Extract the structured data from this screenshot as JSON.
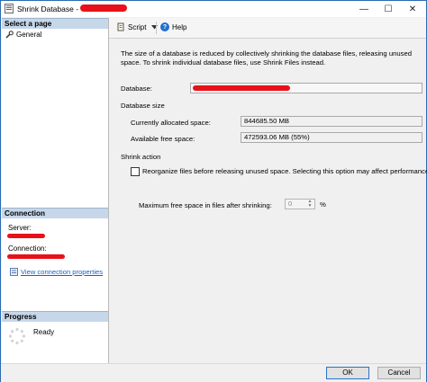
{
  "window": {
    "title": "Shrink Database - ",
    "minimize_glyph": "—",
    "maximize_glyph": "☐",
    "close_glyph": "✕"
  },
  "left": {
    "select_page_header": "Select a page",
    "pages": [
      {
        "label": "General",
        "icon": "wrench-icon"
      }
    ],
    "connection_header": "Connection",
    "server_label": "Server:",
    "connection_label": "Connection:",
    "view_connection_link": "View connection properties",
    "progress_header": "Progress",
    "progress_status": "Ready"
  },
  "toolbar": {
    "script_label": "Script",
    "help_label": "Help"
  },
  "main": {
    "description": "The size of a database is reduced by collectively shrinking the database files, releasing unused space. To shrink individual database files, use Shrink Files instead.",
    "database_label": "Database:",
    "database_size_label": "Database size",
    "allocated_label": "Currently allocated space:",
    "allocated_value": "844685.50 MB",
    "free_label": "Available free space:",
    "free_value": "472593.06 MB (55%)",
    "shrink_action_label": "Shrink action",
    "reorganize_label": "Reorganize files before releasing unused space.  Selecting this option may affect performance.",
    "reorganize_checked": false,
    "max_free_label": "Maximum free space in files after shrinking:",
    "max_free_value": "0",
    "max_free_unit": "%"
  },
  "buttons": {
    "ok_label": "OK",
    "cancel_label": "Cancel"
  },
  "colors": {
    "accent": "#2b6cb3",
    "section_header": "#c6d7ea",
    "link": "#1a5fc8",
    "redaction": "#e8111a"
  }
}
